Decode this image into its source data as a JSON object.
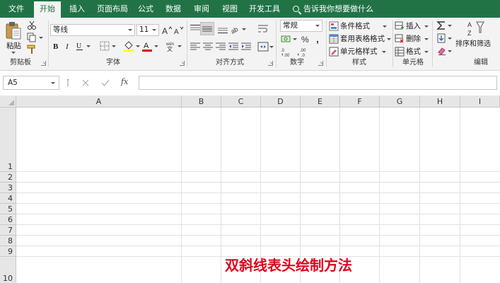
{
  "menu": {
    "tabs": [
      "文件",
      "开始",
      "插入",
      "页面布局",
      "公式",
      "数据",
      "审阅",
      "视图",
      "开发工具"
    ],
    "active_tab": "开始",
    "tell_me": "告诉我你想要做什么"
  },
  "ribbon": {
    "clipboard": {
      "paste_label": "粘贴",
      "group_label": "剪贴板"
    },
    "font": {
      "font_name": "等线",
      "font_size": "11",
      "group_label": "字体"
    },
    "alignment": {
      "group_label": "对齐方式"
    },
    "number": {
      "format": "常规",
      "group_label": "数字"
    },
    "styles": {
      "conditional_format": "条件格式",
      "format_as_table": "套用表格格式",
      "cell_styles": "单元格样式",
      "group_label": "样式"
    },
    "cells": {
      "insert": "插入",
      "delete": "删除",
      "format": "格式",
      "group_label": "单元格"
    },
    "editing": {
      "sort_filter": "排序和筛选",
      "group_label": "编辑"
    }
  },
  "formula_bar": {
    "name_box": "A5",
    "fx_label": "fx",
    "formula": ""
  },
  "grid": {
    "columns": [
      "A",
      "B",
      "C",
      "D",
      "E",
      "F",
      "G",
      "H",
      "I"
    ],
    "rows": [
      "1",
      "2",
      "3",
      "4",
      "5",
      "6",
      "7",
      "8",
      "9",
      "10"
    ]
  },
  "overlay_title": "双斜线表头绘制方法",
  "colors": {
    "excel_green": "#217346",
    "ribbon_bg": "#f3f3f3",
    "title_red": "#e0001b"
  }
}
